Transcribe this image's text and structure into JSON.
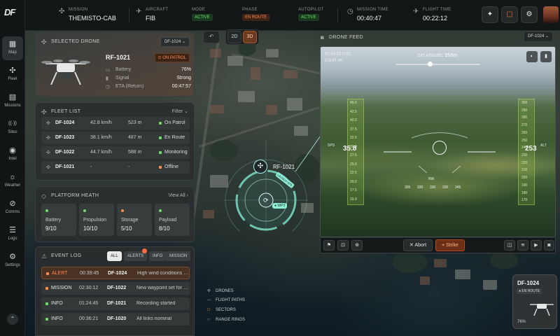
{
  "app": {
    "logo": "DF"
  },
  "sidebar": {
    "items": [
      {
        "label": "Map",
        "icon": "map-icon",
        "glyph": "▦"
      },
      {
        "label": "Fleet",
        "icon": "drone-icon",
        "glyph": "✣"
      },
      {
        "label": "Missions",
        "icon": "document-icon",
        "glyph": "▤"
      },
      {
        "label": "Sites",
        "icon": "signal-icon",
        "glyph": "((·))"
      },
      {
        "label": "Intel",
        "icon": "eye-icon",
        "glyph": "◉"
      },
      {
        "label": "Weather",
        "icon": "sun-icon",
        "glyph": "☼"
      },
      {
        "label": "Comms",
        "icon": "compass-icon",
        "glyph": "⊘"
      },
      {
        "label": "Logs",
        "icon": "logs-icon",
        "glyph": "☰"
      },
      {
        "label": "Settings",
        "icon": "gear-icon",
        "glyph": "⚙"
      }
    ],
    "active": "Map",
    "collapse_glyph": "⌃"
  },
  "topbar": {
    "mission": {
      "label": "MISSION",
      "value": "THEMISTO-CAB"
    },
    "aircraft": {
      "label": "AIRCRAFT",
      "value": "FIB"
    },
    "mode": {
      "label": "MODE",
      "value": "ACTIVE"
    },
    "phase": {
      "label": "PHASE",
      "value": "EN ROUTE"
    },
    "autopilot": {
      "label": "AUTOPILOT",
      "value": "ACTIVE"
    },
    "mission_time": {
      "label": "MISSION TIME",
      "value": "00:40:47"
    },
    "flight_time": {
      "label": "FLIGHT TIME",
      "value": "00:22:12"
    },
    "buttons": [
      "✦",
      "▢",
      "⚙"
    ]
  },
  "selected_drone": {
    "title": "SELECTED DRONE",
    "dropdown": "DF-1024",
    "name": "RF-1021",
    "status": "ON PATROL",
    "battery_label": "Battery",
    "battery_value": "76%",
    "signal_label": "Signal",
    "signal_value": "Strong",
    "eta_label": "ETA (Return)",
    "eta_value": "00:47:57"
  },
  "fleet_list": {
    "title": "FLEET LIST",
    "filter": "Filter",
    "rows": [
      {
        "id": "DF-1024",
        "speed": "42.8 km/h",
        "distance": "523 m",
        "status": "On Patrol",
        "color": "#6fdc67"
      },
      {
        "id": "DF-1023",
        "speed": "38.1 km/h",
        "distance": "487 m",
        "status": "En Route",
        "color": "#6fdc67"
      },
      {
        "id": "DF-1022",
        "speed": "44.7 km/h",
        "distance": "588 m",
        "status": "Monitoring",
        "color": "#6fdc67"
      },
      {
        "id": "DF-1021",
        "speed": "-",
        "distance": "-",
        "status": "Offline",
        "color": "#ff8a4c"
      }
    ]
  },
  "platform_health": {
    "title": "PLATFORM HEATH",
    "view_all": "View All",
    "metrics": [
      {
        "label": "Battery",
        "value": "9/10",
        "color": "green"
      },
      {
        "label": "Propulsion",
        "value": "10/10",
        "color": "green"
      },
      {
        "label": "Storage",
        "value": "5/10",
        "color": "orange"
      },
      {
        "label": "Payload",
        "value": "8/10",
        "color": "green"
      }
    ]
  },
  "event_log": {
    "title": "EVENT LOG",
    "tabs": [
      "ALL",
      "ALERTS",
      "INFO",
      "MISSION"
    ],
    "active_tab": "ALL",
    "rows": [
      {
        "type": "ALERT",
        "time": "00:39:45",
        "drone": "DF-1024",
        "message": "High wind conditions dete...",
        "color": "#ff8a4c"
      },
      {
        "type": "MISSION",
        "time": "02:30:12",
        "drone": "DF-1022",
        "message": "New waypoint set for DF-...",
        "color": "#ff8a4c"
      },
      {
        "type": "INFO",
        "time": "01:24:45",
        "drone": "DF-1021",
        "message": "Recording started",
        "color": "#6fdc67"
      },
      {
        "type": "INFO",
        "time": "00:36:21",
        "drone": "DF-1020",
        "message": "All links nominal",
        "color": "#6fdc67"
      }
    ]
  },
  "map": {
    "view_2d": "2D",
    "view_3d": "3D",
    "back_glyph": "↶",
    "drone_label": "RF-1021",
    "launch_label": "LAUNCH SITE",
    "wp_label": "● WP3",
    "legend": [
      {
        "label": "DRONES",
        "glyph": "✣"
      },
      {
        "label": "FLIGHT PATHS",
        "glyph": "---"
      },
      {
        "label": "SECTORS",
        "glyph": "□"
      },
      {
        "label": "RANGE RINGS",
        "glyph": "○"
      }
    ]
  },
  "drone_feed": {
    "title": "DRONE FEED",
    "dropdown": "DF-1024",
    "timestamp": "02:40:52 UTC",
    "sensor": "EO/IR 4K",
    "set_altitude_label": "Set Altitude:",
    "set_altitude_value": "253m",
    "altitude_fraction": 0.4,
    "speed_value": "35.8",
    "speed_label": "SPD",
    "alt_value": "253",
    "alt_label": "ALT",
    "heading_label": "NW",
    "heading_ticks": [
      "305",
      "330",
      "330",
      "330",
      "345"
    ],
    "speed_ticks": [
      "45.0",
      "42.5",
      "40.0",
      "37.5",
      "32.5",
      "30.0",
      "27.5",
      "25.0",
      "22.5",
      "20.0",
      "17.5",
      "15.0"
    ],
    "alt_ticks": [
      "300",
      "290",
      "280",
      "270",
      "260",
      "250",
      "240",
      "230",
      "220",
      "210",
      "200",
      "190",
      "180",
      "170"
    ],
    "abort_label": "Abort",
    "strike_label": "Strike"
  },
  "mini_card": {
    "id": "DF-1024",
    "status": "EN ROUTE",
    "battery": "76%"
  }
}
